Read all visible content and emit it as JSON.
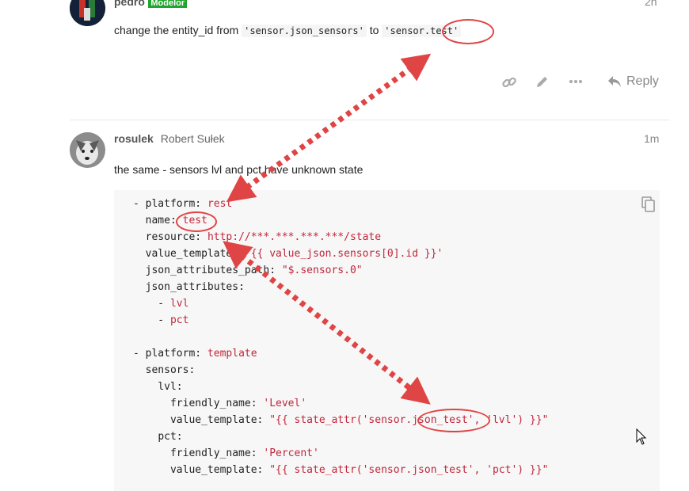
{
  "post1": {
    "username": "pedro",
    "badge": "Modelor",
    "time": "2h",
    "text_before": "change the entity_id from ",
    "code1": "'sensor.json_sensors'",
    "text_middle": " to ",
    "code2": "'sensor.test'",
    "actions": {
      "link_icon": "link-icon",
      "edit_icon": "pencil-icon",
      "more_icon": "ellipsis-icon",
      "reply_label": "Reply"
    }
  },
  "post2": {
    "username": "rosulek",
    "fullname": "Robert Sułek",
    "time": "1m",
    "text": "the same - sensors lvl and pct have unknown state",
    "code_lines": [
      {
        "indent": "- ",
        "key": "platform",
        "sep": ": ",
        "val": "rest"
      },
      {
        "indent": "  ",
        "key": "name",
        "sep": ": ",
        "val": "test"
      },
      {
        "indent": "  ",
        "key": "resource",
        "sep": ": ",
        "val": "http://***.***.***.***/state"
      },
      {
        "indent": "  ",
        "key": "value_template",
        "sep": ": ",
        "val": "'{{ value_json.sensors[0].id }}'"
      },
      {
        "indent": "  ",
        "key": "json_attributes_path",
        "sep": ": ",
        "val": "\"$.sensors.0\""
      },
      {
        "indent": "  ",
        "key": "json_attributes",
        "sep": ":",
        "val": ""
      },
      {
        "indent": "    - ",
        "key": "",
        "sep": "",
        "val": "lvl"
      },
      {
        "indent": "    - ",
        "key": "",
        "sep": "",
        "val": "pct"
      },
      {
        "indent": "",
        "key": "",
        "sep": "",
        "val": ""
      },
      {
        "indent": "- ",
        "key": "platform",
        "sep": ": ",
        "val": "template"
      },
      {
        "indent": "  ",
        "key": "sensors",
        "sep": ":",
        "val": ""
      },
      {
        "indent": "    ",
        "key": "lvl",
        "sep": ":",
        "val": ""
      },
      {
        "indent": "      ",
        "key": "friendly_name",
        "sep": ": ",
        "val": "'Level'"
      },
      {
        "indent": "      ",
        "key": "value_template",
        "sep": ": ",
        "val": "\"{{ state_attr('sensor.json_test', 'lvl') }}\""
      },
      {
        "indent": "    ",
        "key": "pct",
        "sep": ":",
        "val": ""
      },
      {
        "indent": "      ",
        "key": "friendly_name",
        "sep": ": ",
        "val": "'Percent'"
      },
      {
        "indent": "      ",
        "key": "value_template",
        "sep": ": ",
        "val": "\"{{ state_attr('sensor.json_test', 'pct') }}\""
      }
    ],
    "copy_icon": "copy-icon"
  },
  "colors": {
    "annotation_red": "#e04545",
    "yaml_value": "#c0263b",
    "badge_green": "#22a52c"
  }
}
